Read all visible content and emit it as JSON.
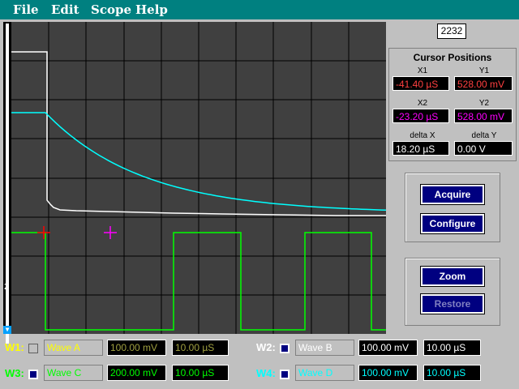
{
  "menu": {
    "file": "File",
    "edit": "Edit",
    "scope": "Scope",
    "help": "Help"
  },
  "counter": "2232",
  "left_marker": "2",
  "cursor": {
    "title": "Cursor Positions",
    "x1_label": "X1",
    "x1_value": "-41.40 µS",
    "y1_label": "Y1",
    "y1_value": "528.00 mV",
    "x2_label": "X2",
    "x2_value": "-23.20 µS",
    "y2_label": "Y2",
    "y2_value": "528.00 mV",
    "dx_label": "delta X",
    "dx_value": "18.20 µS",
    "dy_label": "delta Y",
    "dy_value": "0.00 V"
  },
  "buttons": {
    "acquire": "Acquire",
    "configure": "Configure",
    "zoom": "Zoom",
    "restore": "Restore"
  },
  "waves": [
    {
      "id": "W1:",
      "name": "Wave A",
      "volts": "100.00 mV",
      "time": "10.00 µS",
      "color": "#ffff00",
      "checked": false
    },
    {
      "id": "W2:",
      "name": "Wave B",
      "volts": "100.00 mV",
      "time": "10.00 µS",
      "color": "#ffffff",
      "checked": true
    },
    {
      "id": "W3:",
      "name": "Wave C",
      "volts": "200.00 mV",
      "time": "10.00 µS",
      "color": "#00ff00",
      "checked": true
    },
    {
      "id": "W4:",
      "name": "Wave D",
      "volts": "100.00 mV",
      "time": "10.00 µS",
      "color": "#00ffff",
      "checked": true
    }
  ],
  "colors": {
    "cursor1": "#ff0000",
    "cursor2": "#ff00ff",
    "x_values": "#ff4040",
    "x2_values": "#ff00ff",
    "y1_values": "#ff4040",
    "y2_values": "#ff00ff"
  }
}
